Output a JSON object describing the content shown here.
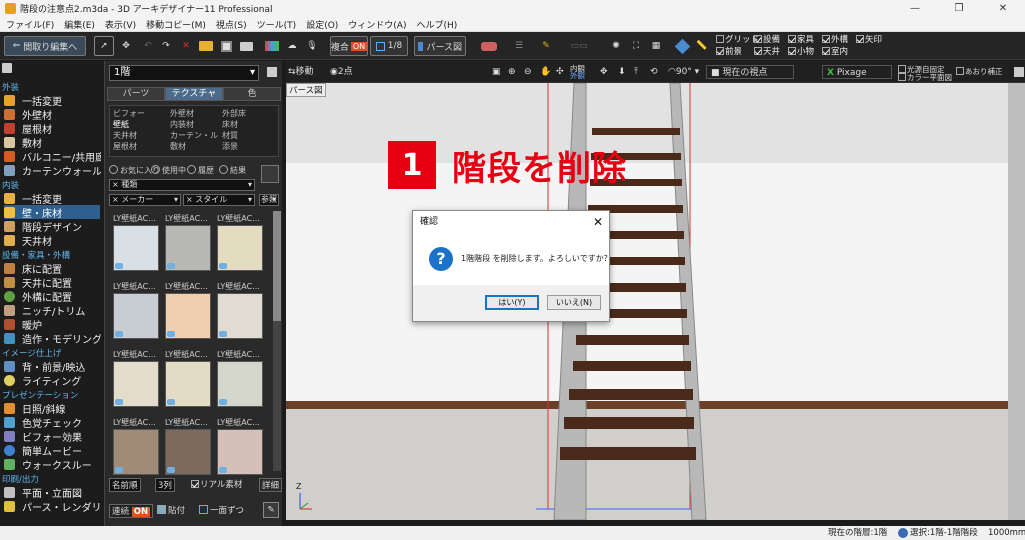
{
  "window": {
    "title": "階段の注意点2.m3da - 3D アーキデザイナー11 Professional",
    "controls": [
      "—",
      "❐",
      "✕"
    ]
  },
  "menu": [
    "ファイル(F)",
    "編集(E)",
    "表示(V)",
    "移動コピー(M)",
    "視点(S)",
    "ツール(T)",
    "設定(O)",
    "ウィンドウ(A)",
    "ヘルプ(H)"
  ],
  "toolbar": {
    "back_label": "間取り編集へ",
    "floor_label": "複合",
    "floor_toggle": "ON",
    "scale_label": "1/8",
    "view_label": "パース図",
    "checks": [
      {
        "label": "グリッド",
        "checked": false
      },
      {
        "label": "設備",
        "checked": true
      },
      {
        "label": "家具",
        "checked": true
      },
      {
        "label": "外構",
        "checked": true
      },
      {
        "label": "矢印",
        "checked": true
      },
      {
        "label": "前景",
        "checked": true
      },
      {
        "label": "天井",
        "checked": true
      },
      {
        "label": "小物",
        "checked": true
      },
      {
        "label": "室内",
        "checked": true
      }
    ]
  },
  "sidebar": {
    "sections": [
      {
        "title": "外装",
        "items": [
          {
            "label": "一括変更",
            "color": "#e8a030"
          },
          {
            "label": "外壁材",
            "color": "#d07030"
          },
          {
            "label": "屋根材",
            "color": "#c04030"
          },
          {
            "label": "敷材",
            "color": "#d8c8a0"
          },
          {
            "label": "バルコニー/共用廊下",
            "color": "#d06020"
          },
          {
            "label": "カーテンウォール",
            "color": "#80a0c0"
          }
        ]
      },
      {
        "title": "内装",
        "items": [
          {
            "label": "一括変更",
            "color": "#e8b040"
          },
          {
            "label": "壁・床材",
            "color": "#f0c040",
            "selected": true
          },
          {
            "label": "階段デザイン",
            "color": "#d0a060"
          },
          {
            "label": "天井材",
            "color": "#e0b050"
          }
        ]
      },
      {
        "title": "設備・家具・外構",
        "items": [
          {
            "label": "床に配置",
            "color": "#c08040"
          },
          {
            "label": "天井に配置",
            "color": "#c09040"
          },
          {
            "label": "外構に配置",
            "color": "#60a040"
          },
          {
            "label": "ニッチ/トリム",
            "color": "#c0a080"
          },
          {
            "label": "暖炉",
            "color": "#b05030"
          },
          {
            "label": "造作・モデリング",
            "color": "#4090c0"
          }
        ]
      },
      {
        "title": "イメージ仕上げ",
        "items": [
          {
            "label": "背・前景/映込",
            "color": "#6090c0"
          },
          {
            "label": "ライティング",
            "color": "#e0d060"
          }
        ]
      },
      {
        "title": "プレゼンテーション",
        "items": [
          {
            "label": "日照/斜線",
            "color": "#e09030"
          },
          {
            "label": "色覚チェック",
            "color": "#50a0d0"
          },
          {
            "label": "ビフォー効果",
            "color": "#8080c0"
          },
          {
            "label": "簡単ムービー",
            "color": "#4080d0"
          },
          {
            "label": "ウォークスルー",
            "color": "#60b060"
          }
        ]
      },
      {
        "title": "印刷/出力",
        "items": [
          {
            "label": "平面・立面図",
            "color": "#c0c0c0"
          },
          {
            "label": "パース・レンダリング",
            "color": "#e0c040"
          }
        ]
      }
    ]
  },
  "panel": {
    "floor": "1階",
    "tabs": [
      {
        "label": "パーツ"
      },
      {
        "label": "テクスチャ",
        "active": true
      },
      {
        "label": "色"
      }
    ],
    "categories": [
      [
        "ビフォー",
        "外壁材",
        "外部床"
      ],
      [
        "壁紙",
        "内装材",
        "床材"
      ],
      [
        "天井材",
        "カーテン・ル",
        "材質"
      ],
      [
        "屋根材",
        "敷材",
        "添景"
      ]
    ],
    "selected_category": "壁紙",
    "filters": [
      "お気に入り",
      "使用中",
      "履歴",
      "結果"
    ],
    "filter_category": "× 種類",
    "filter_maker": "× メーカー",
    "filter_style": "× スタイル",
    "filter_button": "参照",
    "swatches": [
      {
        "label": "LY壁紙AC...",
        "color": "#d8e0e6"
      },
      {
        "label": "LY壁紙AC...",
        "color": "#b8b8b4"
      },
      {
        "label": "LY壁紙AC...",
        "color": "#e4dcc0"
      },
      {
        "label": "LY壁紙AC...",
        "color": "#c8cdd4"
      },
      {
        "label": "LY壁紙AC...",
        "color": "#f0cfb0"
      },
      {
        "label": "LY壁紙AC...",
        "color": "#e0dcd4"
      },
      {
        "label": "LY壁紙AC...",
        "color": "#e4dccb"
      },
      {
        "label": "LY壁紙AC...",
        "color": "#e2dcc4"
      },
      {
        "label": "LY壁紙AC...",
        "color": "#d4d6cc"
      },
      {
        "label": "LY壁紙AC...",
        "color": "#a08c76"
      },
      {
        "label": "LY壁紙AC...",
        "color": "#7c6a5c"
      },
      {
        "label": "LY壁紙AC...",
        "color": "#d4c0b8"
      }
    ],
    "sort_label": "名前順",
    "columns_label": "3列",
    "recommend_label": "リアル素材",
    "detail_label": "詳細",
    "continuous_label": "連続",
    "continuous_toggle": "ON",
    "paste_label": "貼付",
    "face_label": "一面ずつ"
  },
  "viewbar": {
    "move_label": "移動",
    "two_point_label": "2点",
    "inner_label": "内観",
    "outer_label": "外観",
    "angle_label": "90°",
    "current_view_label": "現在の視点",
    "pixage_label": "Pixage",
    "lighting_check": "光源自固定",
    "color_check": "カラー平面図",
    "perspective_check": "あおり補正"
  },
  "viewport": {
    "label": "パース図"
  },
  "annotation": {
    "number": "1",
    "text": "階段を削除"
  },
  "dialog": {
    "title": "確認",
    "message": "1階階段 を削除します。よろしいですか？",
    "yes_label": "はい(Y)",
    "no_label": "いいえ(N)"
  },
  "statusbar": {
    "floor": "現在の階層:1階",
    "selection": "選択:1階-1階階段",
    "size": "1000mm"
  }
}
